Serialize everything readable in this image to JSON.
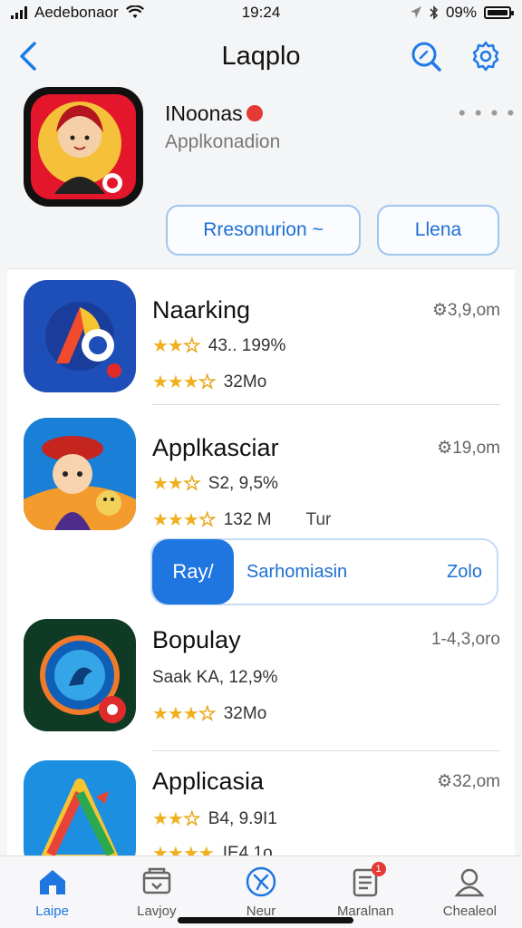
{
  "status_bar": {
    "carrier": "Aedebonaor",
    "time": "19:24",
    "battery": "09%"
  },
  "nav": {
    "title": "Laqplo"
  },
  "hero": {
    "name": "INoonas",
    "subtitle": "Applkonadion",
    "more": "• • • •",
    "button_primary": "Rresonurion ~",
    "button_secondary": "Llena"
  },
  "apps": [
    {
      "name": "Naarking",
      "size": "⚙3,9,om",
      "rating_text": "43..  199%",
      "secondary": "32Mo"
    },
    {
      "name": "Applkasciar",
      "size": "⚙19,om",
      "rating_text": "S2,  9,5%",
      "secondary": "132 M",
      "extra": "Tur"
    },
    {
      "name": "Bopulay",
      "size": "1-4,3,oro",
      "rating_text": "Saak KA,  12,9%",
      "secondary": "32Mo"
    },
    {
      "name": "Applicasia",
      "size": "⚙32,om",
      "rating_text": "B4,  9.9I1",
      "secondary": "IE4 1o"
    }
  ],
  "action_row": {
    "play_label": "Ray/",
    "middle_label": "Sarhomiasin",
    "right_label": "Zolo"
  },
  "tabs": [
    {
      "label": "Laipe",
      "icon": "home-icon",
      "active": true
    },
    {
      "label": "Lavjoy",
      "icon": "games-icon",
      "active": false
    },
    {
      "label": "Neur",
      "icon": "compass-icon",
      "active": false
    },
    {
      "label": "Maralnan",
      "icon": "news-icon",
      "badge": "1",
      "active": false
    },
    {
      "label": "Chealeol",
      "icon": "profile-icon",
      "active": false
    }
  ],
  "colors": {
    "accent": "#1f76e0",
    "star": "#f0b01e",
    "badge": "#e53935"
  }
}
